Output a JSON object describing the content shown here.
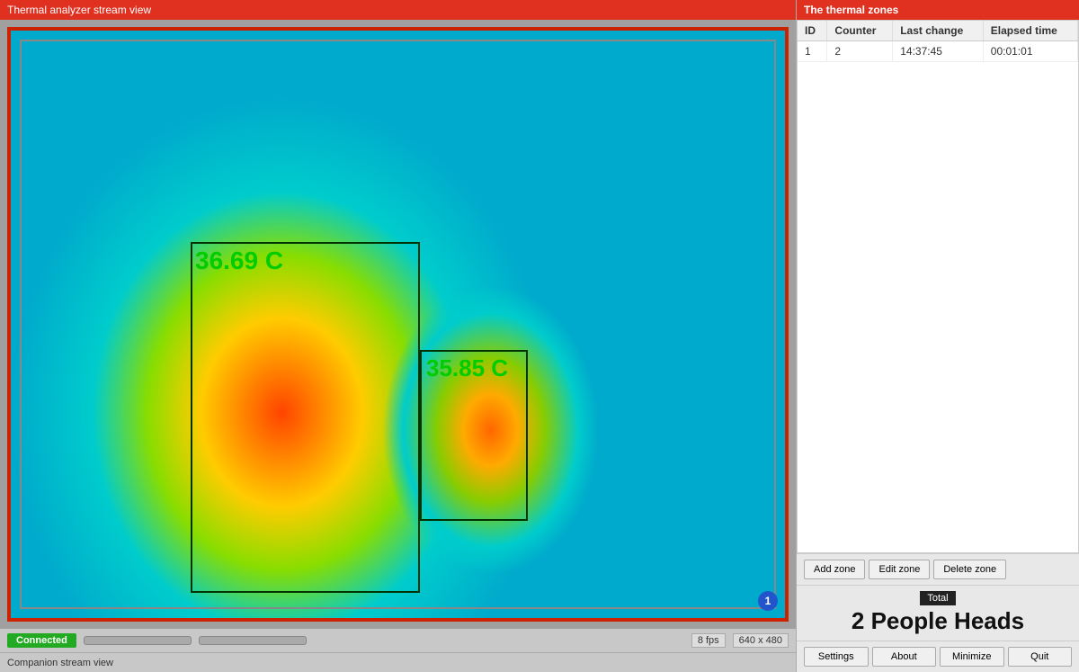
{
  "app": {
    "stream_title": "Thermal analyzer stream view",
    "companion_title": "Companion stream view"
  },
  "thermal": {
    "temp1": "36.69 C",
    "temp2": "35.85 C",
    "fps": "8 fps",
    "resolution": "640 x 480",
    "status": "Connected",
    "counter_badge": "1"
  },
  "zones_panel": {
    "title": "The thermal zones",
    "table": {
      "headers": [
        "ID",
        "Counter",
        "Last change",
        "Elapsed time"
      ],
      "rows": [
        {
          "id": "1",
          "counter": "2",
          "last_change": "14:37:45",
          "elapsed_time": "00:01:01"
        }
      ]
    },
    "buttons": {
      "add_zone": "Add zone",
      "edit_zone": "Edit zone",
      "delete_zone": "Delete zone"
    },
    "total_label": "Total",
    "total_count": "2 People Heads"
  },
  "bottom_buttons": {
    "settings": "Settings",
    "about": "About",
    "minimize": "Minimize",
    "quit": "Quit"
  }
}
